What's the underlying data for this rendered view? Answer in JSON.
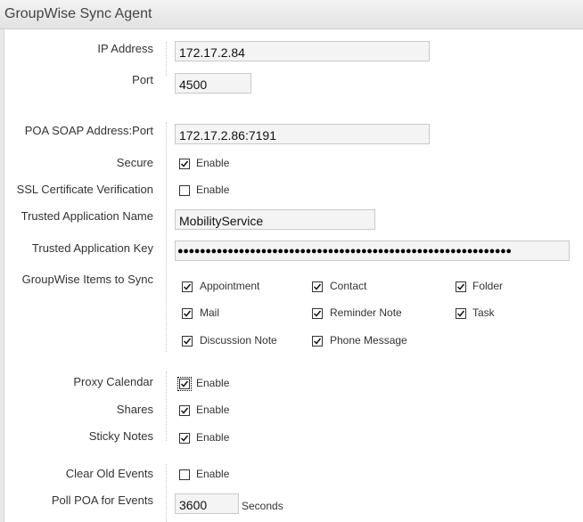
{
  "header": {
    "title": "GroupWise Sync Agent"
  },
  "fields": {
    "ip_address": {
      "label": "IP Address",
      "value": "172.17.2.84"
    },
    "port": {
      "label": "Port",
      "value": "4500"
    },
    "poa_soap": {
      "label": "POA SOAP Address:Port",
      "value": "172.17.2.86:7191"
    },
    "secure": {
      "label": "Secure",
      "option": "Enable",
      "checked": true
    },
    "ssl_verification": {
      "label": "SSL Certificate Verification",
      "option": "Enable",
      "checked": false
    },
    "trusted_app_name": {
      "label": "Trusted Application Name",
      "value": "MobilityService"
    },
    "trusted_app_key": {
      "label": "Trusted Application Key",
      "value": "●●●●●●●●●●●●●●●●●●●●●●●●●●●●●●●●●●●●●●●●●●●●●●●●●●●●●●●●●●●●"
    },
    "items_to_sync": {
      "label": "GroupWise Items to Sync",
      "items": [
        {
          "label": "Appointment",
          "checked": true
        },
        {
          "label": "Contact",
          "checked": true
        },
        {
          "label": "Folder",
          "checked": true
        },
        {
          "label": "Mail",
          "checked": true
        },
        {
          "label": "Reminder Note",
          "checked": true
        },
        {
          "label": "Task",
          "checked": true
        },
        {
          "label": "Discussion Note",
          "checked": true
        },
        {
          "label": "Phone Message",
          "checked": true
        }
      ]
    },
    "proxy_calendar": {
      "label": "Proxy Calendar",
      "option": "Enable",
      "checked": true
    },
    "shares": {
      "label": "Shares",
      "option": "Enable",
      "checked": true
    },
    "sticky_notes": {
      "label": "Sticky Notes",
      "option": "Enable",
      "checked": true
    },
    "clear_old_events": {
      "label": "Clear Old Events",
      "option": "Enable",
      "checked": false
    },
    "poll_poa": {
      "label": "Poll POA for Events",
      "value": "3600",
      "unit": "Seconds"
    }
  }
}
